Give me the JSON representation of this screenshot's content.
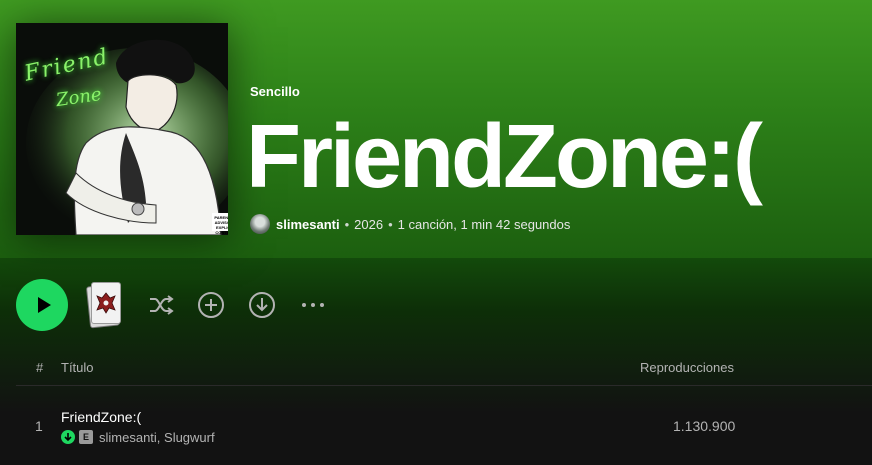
{
  "album": {
    "type_label": "Sencillo",
    "title": "FriendZone:(",
    "cover_title": "Friend",
    "cover_sub": "Zone",
    "cover_advisory": "PARENTAL ADVISORY EXPLICIT CONTENT",
    "artist": "slimesanti",
    "year": "2026",
    "summary": "1 canción, 1 min 42 segundos"
  },
  "actions": {
    "play_icon": "play-icon",
    "shuffle_icon": "shuffle-icon",
    "add_icon": "add-circle-icon",
    "download_icon": "download-circle-icon",
    "more_icon": "more-options-icon"
  },
  "table": {
    "headers": {
      "number": "#",
      "title": "Título",
      "plays": "Reproducciones"
    },
    "rows": [
      {
        "number": "1",
        "title": "FriendZone:(",
        "explicit": "E",
        "artists": "slimesanti, Slugwurf",
        "plays": "1.130.900"
      }
    ]
  },
  "colors": {
    "accent": "#1ed760",
    "hero_top": "#3f9a21",
    "background": "#121212"
  }
}
